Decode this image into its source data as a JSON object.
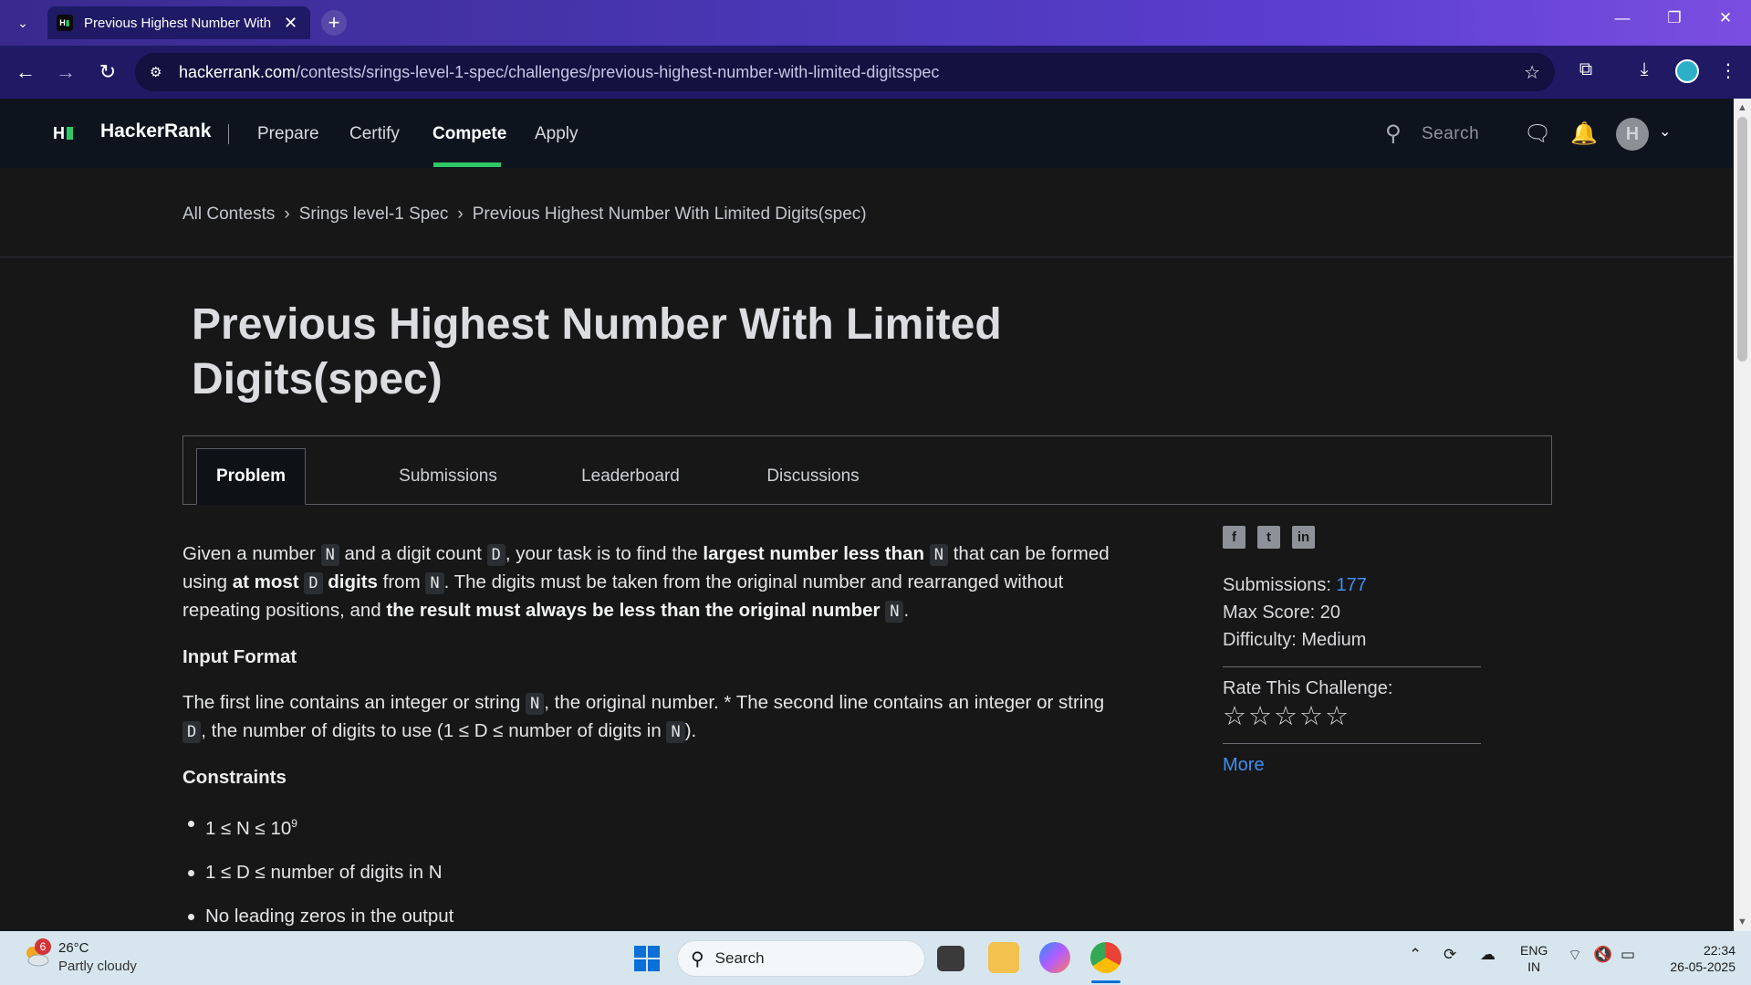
{
  "browser": {
    "tab_title": "Previous Highest Number With",
    "url_host": "hackerrank.com",
    "url_path": "/contests/srings-level-1-spec/challenges/previous-highest-number-with-limited-digitsspec"
  },
  "header": {
    "brand": "HackerRank",
    "nav": [
      "Prepare",
      "Certify",
      "Compete",
      "Apply"
    ],
    "active_nav": "Compete",
    "search_label": "Search",
    "avatar_letter": "H",
    "accent_color": "#2ec866"
  },
  "breadcrumb": [
    "All Contests",
    "Srings level-1 Spec",
    "Previous Highest Number With Limited Digits(spec)"
  ],
  "page_title": "Previous Highest Number With Limited Digits(spec)",
  "tabs": [
    "Problem",
    "Submissions",
    "Leaderboard",
    "Discussions"
  ],
  "active_tab": "Problem",
  "problem": {
    "p1": {
      "t1": "Given a number ",
      "c1": "N",
      "t2": " and a digit count ",
      "c2": "D",
      "t3": ", your task is to find the ",
      "b1": "largest number less than",
      "t4": " ",
      "c3": "N",
      "t5": " that can be formed using ",
      "b2": "at most",
      "t6": " ",
      "c4": "D",
      "t7": " ",
      "b3": "digits",
      "t8": " from ",
      "c5": "N",
      "t9": ". The digits must be taken from the original number and rearranged without repeating positions, and ",
      "b4": "the result must always be less than the original number",
      "t10": " ",
      "c6": "N",
      "t11": "."
    },
    "input_format_heading": "Input Format",
    "p2": {
      "t1": "The first line contains an integer or string ",
      "c1": "N",
      "t2": ", the original number. * The second line contains an integer or string ",
      "c2": "D",
      "t3": ", the number of digits to use (1 ≤ D ≤ number of digits in ",
      "c3": "N",
      "t4": ")."
    },
    "constraints_heading": "Constraints",
    "constraints": [
      {
        "text": "1 ≤ N ≤ 10",
        "sup": "9"
      },
      {
        "text": "1 ≤ D ≤ number of digits in N",
        "sup": ""
      },
      {
        "text": "No leading zeros in the output",
        "sup": ""
      }
    ]
  },
  "sidebar": {
    "submissions_label": "Submissions: ",
    "submissions_value": "177",
    "max_score": "Max Score: 20",
    "difficulty": "Difficulty: Medium",
    "rate_label": "Rate This Challenge:",
    "stars": "☆☆☆☆☆",
    "more_link": "More",
    "social_icons": [
      "facebook-icon",
      "twitter-icon",
      "linkedin-icon"
    ]
  },
  "taskbar": {
    "weather_badge": "6",
    "temperature": "26°C",
    "weather": "Partly cloudy",
    "search_label": "Search",
    "lang_top": "ENG",
    "lang_bottom": "IN",
    "time": "22:34",
    "date": "26-05-2025"
  }
}
